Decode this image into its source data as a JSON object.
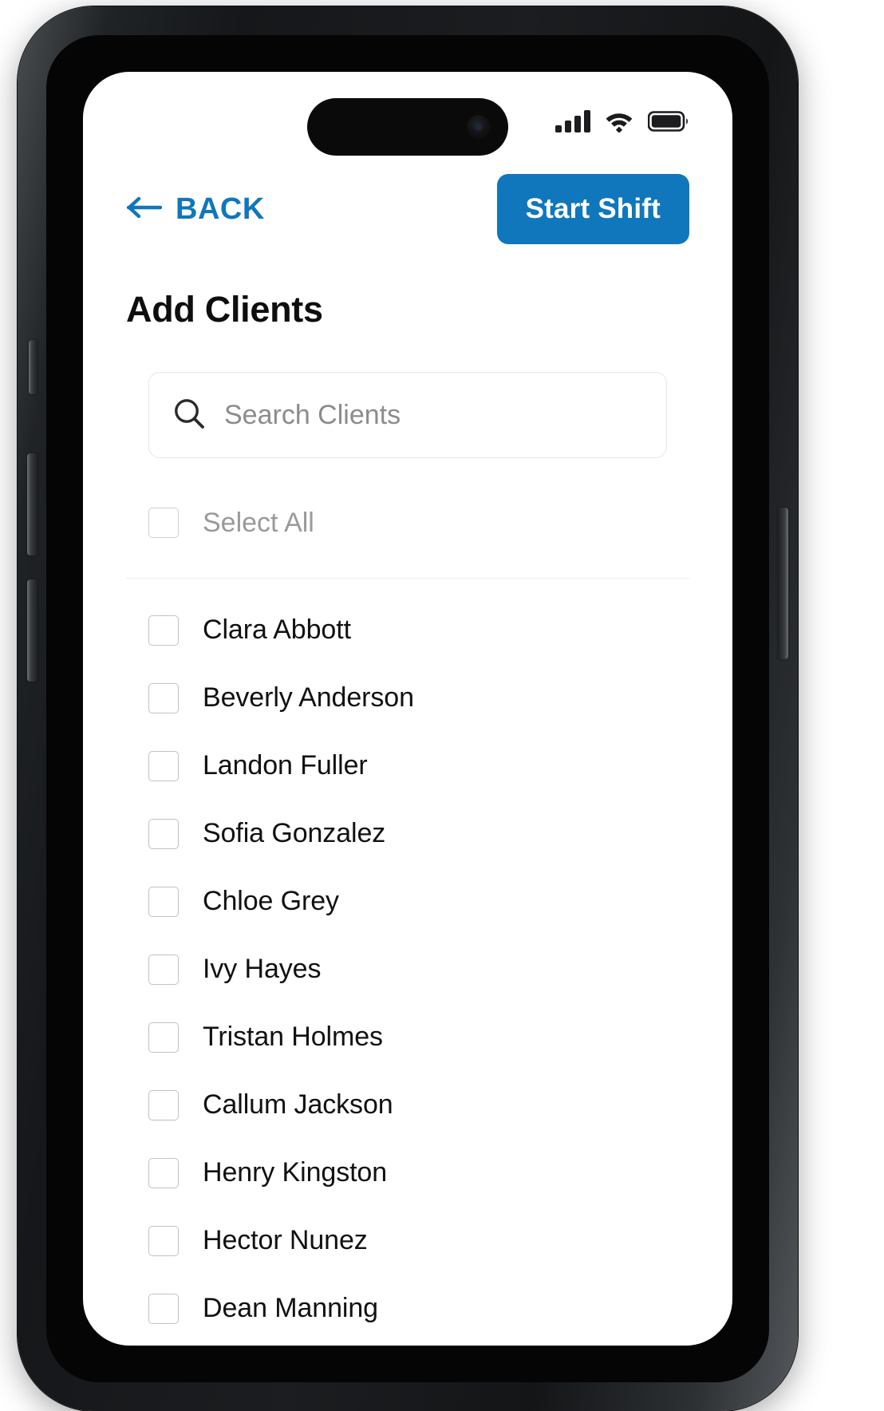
{
  "status_bar": {
    "signal_icon": "signal-bars-icon",
    "wifi_icon": "wifi-icon",
    "battery_icon": "battery-icon"
  },
  "nav": {
    "back_label": "BACK",
    "back_icon": "arrow-left-icon",
    "start_shift_label": "Start Shift"
  },
  "page": {
    "title": "Add Clients"
  },
  "search": {
    "placeholder": "Search Clients",
    "value": "",
    "icon": "search-icon"
  },
  "select_all": {
    "label": "Select All",
    "checked": false
  },
  "clients": [
    {
      "name": "Clara Abbott",
      "checked": false
    },
    {
      "name": "Beverly Anderson",
      "checked": false
    },
    {
      "name": "Landon Fuller",
      "checked": false
    },
    {
      "name": "Sofia Gonzalez",
      "checked": false
    },
    {
      "name": "Chloe Grey",
      "checked": false
    },
    {
      "name": "Ivy Hayes",
      "checked": false
    },
    {
      "name": "Tristan Holmes",
      "checked": false
    },
    {
      "name": "Callum Jackson",
      "checked": false
    },
    {
      "name": "Henry Kingston",
      "checked": false
    },
    {
      "name": "Hector Nunez",
      "checked": false
    },
    {
      "name": "Dean Manning",
      "checked": false
    }
  ],
  "colors": {
    "accent": "#1077BC",
    "text_primary": "#111111",
    "text_muted": "#9a9a9a",
    "border": "#e4e6e8",
    "frame": "#1b1d20"
  }
}
